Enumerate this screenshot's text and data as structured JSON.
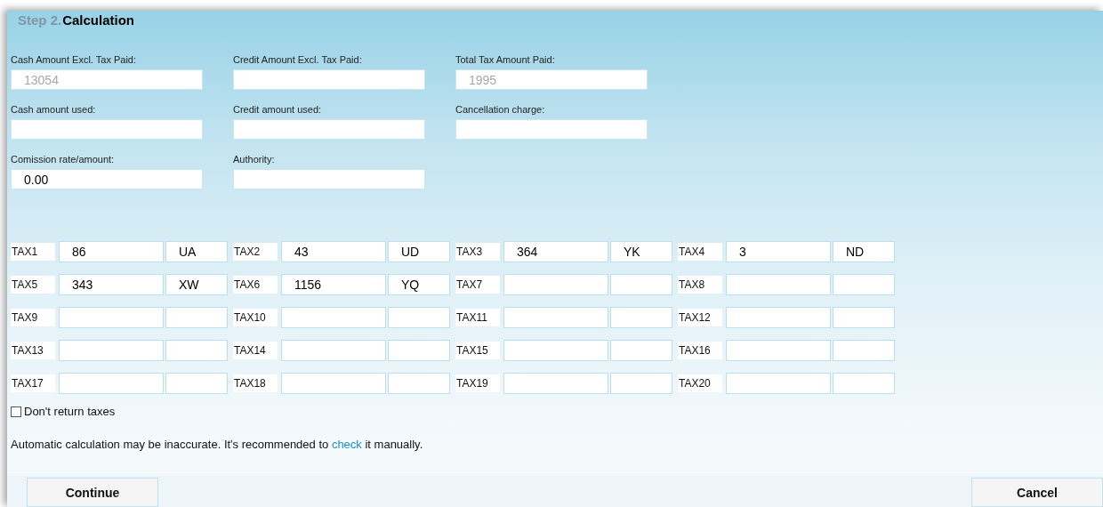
{
  "heading": {
    "step": "Step 2.",
    "title": "Calculation"
  },
  "fields": [
    {
      "label": "Cash Amount Excl. Tax Paid:",
      "placeholder": "13054"
    },
    {
      "label": "Credit Amount Excl. Tax Paid:"
    },
    {
      "label": "Total Tax Amount Paid:",
      "placeholder": "1995"
    },
    {
      "label": "Cash amount used:"
    },
    {
      "label": "Credit amount used:"
    },
    {
      "label": "Cancellation charge:"
    },
    {
      "label": "Comission rate/amount:",
      "value": "0.00"
    },
    {
      "label": "Authority:"
    }
  ],
  "taxes": [
    {
      "label": "TAX1",
      "amount": "86",
      "code": "UA"
    },
    {
      "label": "TAX2",
      "amount": "43",
      "code": "UD"
    },
    {
      "label": "TAX3",
      "amount": "364",
      "code": "YK"
    },
    {
      "label": "TAX4",
      "amount": "3",
      "code": "ND"
    },
    {
      "label": "TAX5",
      "amount": "343",
      "code": "XW"
    },
    {
      "label": "TAX6",
      "amount": "1156",
      "code": "YQ"
    },
    {
      "label": "TAX7"
    },
    {
      "label": "TAX8"
    },
    {
      "label": "TAX9"
    },
    {
      "label": "TAX10"
    },
    {
      "label": "TAX11"
    },
    {
      "label": "TAX12"
    },
    {
      "label": "TAX13"
    },
    {
      "label": "TAX14"
    },
    {
      "label": "TAX15"
    },
    {
      "label": "TAX16"
    },
    {
      "label": "TAX17"
    },
    {
      "label": "TAX18"
    },
    {
      "label": "TAX19"
    },
    {
      "label": "TAX20"
    }
  ],
  "dont_return_taxes": {
    "label": "Don't return taxes",
    "checked": false
  },
  "notice": {
    "text_before": "Automatic calculation may be inaccurate. It's recommended to ",
    "link": "check",
    "text_after": " it manually."
  },
  "buttons": [
    {
      "label": "Continue"
    },
    {
      "label": "Cancel"
    }
  ]
}
